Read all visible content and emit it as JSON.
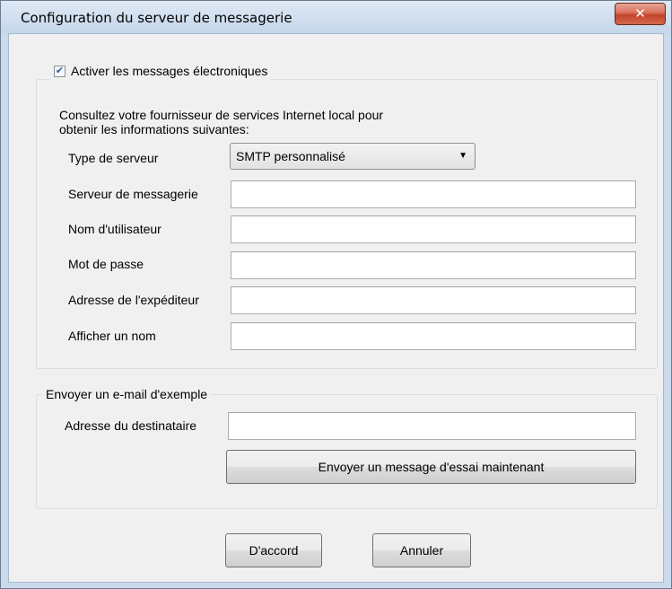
{
  "window": {
    "title": "Configuration du serveur de messagerie",
    "close_glyph": "✕"
  },
  "email_group": {
    "enable_label": "Activer les messages électroniques",
    "enable_checked": true,
    "info_line1": "Consultez votre fournisseur de services Internet local pour",
    "info_line2": "obtenir les informations suivantes:",
    "server_type_label": "Type de serveur",
    "server_type_value": "SMTP personnalisé",
    "mail_server_label": "Serveur de messagerie",
    "mail_server_value": "",
    "username_label": "Nom d'utilisateur",
    "username_value": "",
    "password_label": "Mot de passe",
    "password_value": "",
    "sender_label": "Adresse de l'expéditeur",
    "sender_value": "",
    "display_name_label": "Afficher un nom",
    "display_name_value": ""
  },
  "test_group": {
    "title": "Envoyer un e-mail d'exemple",
    "recipient_label": "Adresse du destinataire",
    "recipient_value": "",
    "send_button": "Envoyer un message d'essai maintenant"
  },
  "footer": {
    "ok_button": "D'accord",
    "cancel_button": "Annuler"
  }
}
